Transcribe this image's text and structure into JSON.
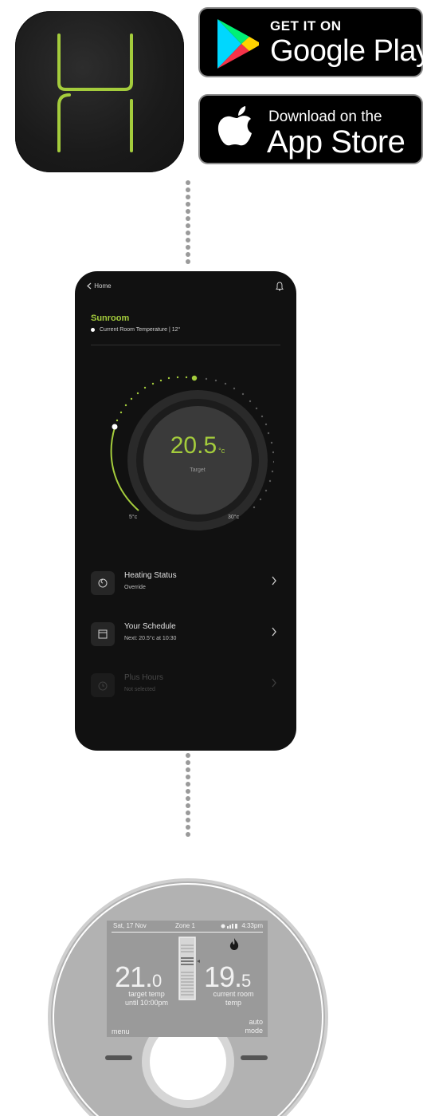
{
  "app_icon": {
    "name": "app-icon"
  },
  "google_play": {
    "small": "GET IT ON",
    "big": "Google Play"
  },
  "app_store": {
    "small": "Download on the",
    "big": "App Store"
  },
  "phone": {
    "back_label": "Home",
    "room_name": "Sunroom",
    "current_temp": "Current Room Temperature  |  12°",
    "target_value": "20.5",
    "target_unit": "°c",
    "target_label": "Target",
    "min_label": "5°c",
    "max_label": "30°c",
    "rows": [
      {
        "title": "Heating Status",
        "sub": "Override"
      },
      {
        "title": "Your Schedule",
        "sub": "Next: 20.5°c at 10:30"
      },
      {
        "title": "Plus Hours",
        "sub": "Not selected"
      }
    ],
    "accent": "#a4cc3c"
  },
  "thermostat": {
    "date": "Sat, 17 Nov",
    "zone": "Zone 1",
    "time": "4:33pm",
    "target_int": "21.",
    "target_dec": "0",
    "target_line1": "target temp",
    "target_line2": "until 10:00pm",
    "current_int": "19.",
    "current_dec": "5",
    "current_line1": "current room",
    "current_line2": "temp",
    "menu_label": "menu",
    "auto_line1": "auto",
    "auto_line2": "mode"
  }
}
